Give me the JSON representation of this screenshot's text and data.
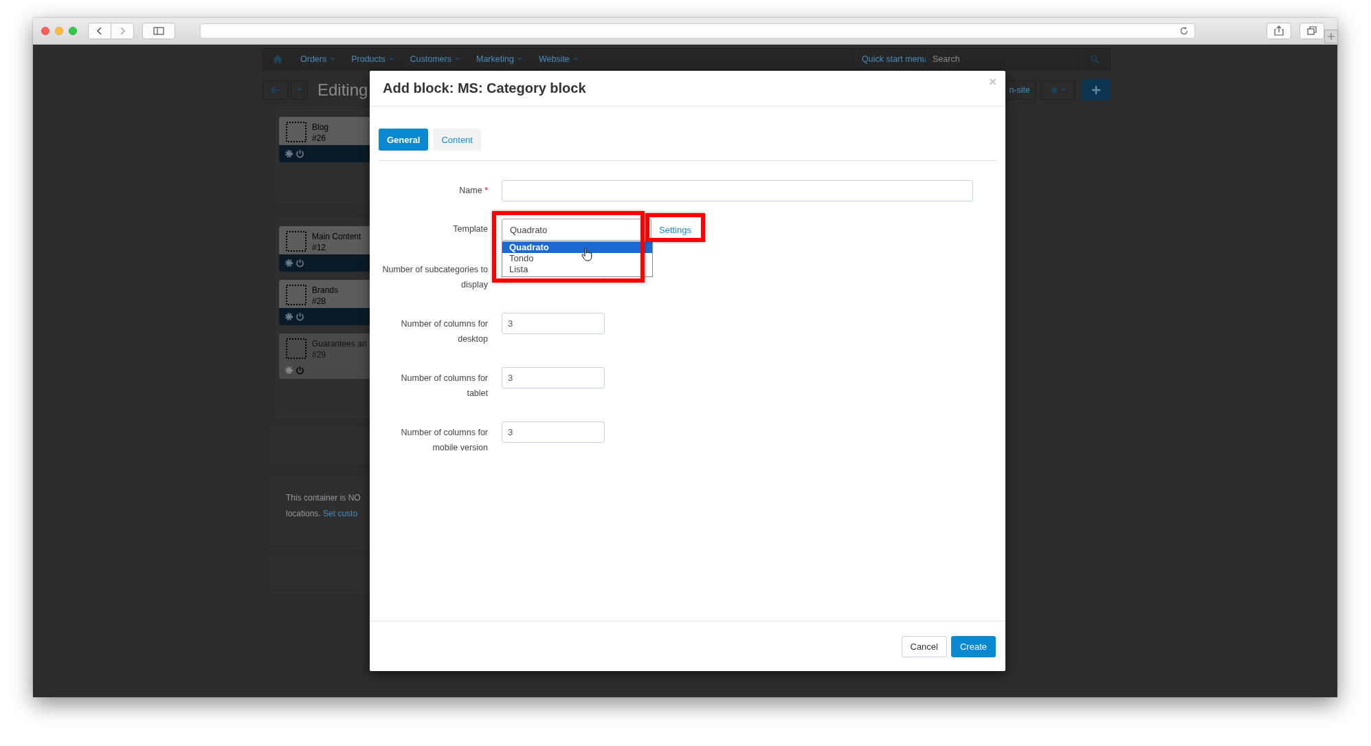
{
  "admin_page": {
    "nav": {
      "items": [
        {
          "label": "Orders"
        },
        {
          "label": "Products"
        },
        {
          "label": "Customers"
        },
        {
          "label": "Marketing"
        },
        {
          "label": "Website"
        }
      ],
      "quick_start": "Quick start menu",
      "search_placeholder": "Search"
    },
    "page_title": "Editing",
    "view_button": "n-site",
    "blocks": [
      {
        "name": "Blog",
        "id": "#26",
        "enabled": true
      },
      {
        "name": "Main Content",
        "id": "#12",
        "enabled": true
      },
      {
        "name": "Brands",
        "id": "#28",
        "enabled": true
      },
      {
        "name": "Guarantees an",
        "id": "#29",
        "enabled": false
      }
    ],
    "notice": {
      "line1": "This container is NO",
      "line2": "locations.",
      "link": "Set custo"
    }
  },
  "modal": {
    "title": "Add block: MS: Category block",
    "close": "×",
    "tabs": [
      {
        "label": "General",
        "selected": true
      },
      {
        "label": "Content",
        "selected": false
      }
    ],
    "fields": [
      {
        "kind": "text",
        "label": "Name",
        "required_mark": "*"
      },
      {
        "kind": "select",
        "label": "Template",
        "value": "Quadrato",
        "link": "Settings",
        "expanded": true,
        "options": [
          {
            "label": "Quadrato",
            "selected": true
          },
          {
            "label": "Tondo",
            "selected": false
          },
          {
            "label": "Lista",
            "selected": false
          }
        ]
      },
      {
        "kind": "number",
        "label": "Number of subcategories to display"
      },
      {
        "kind": "number",
        "label": "Number of columns for desktop",
        "value": "3"
      },
      {
        "kind": "number",
        "label": "Number of columns for tablet",
        "value": "3"
      },
      {
        "kind": "number",
        "label": "Number of columns for mobile version",
        "value": "3"
      }
    ],
    "buttons": [
      {
        "label": "Cancel",
        "kind": "secondary"
      },
      {
        "label": "Create",
        "kind": "primary"
      }
    ]
  }
}
